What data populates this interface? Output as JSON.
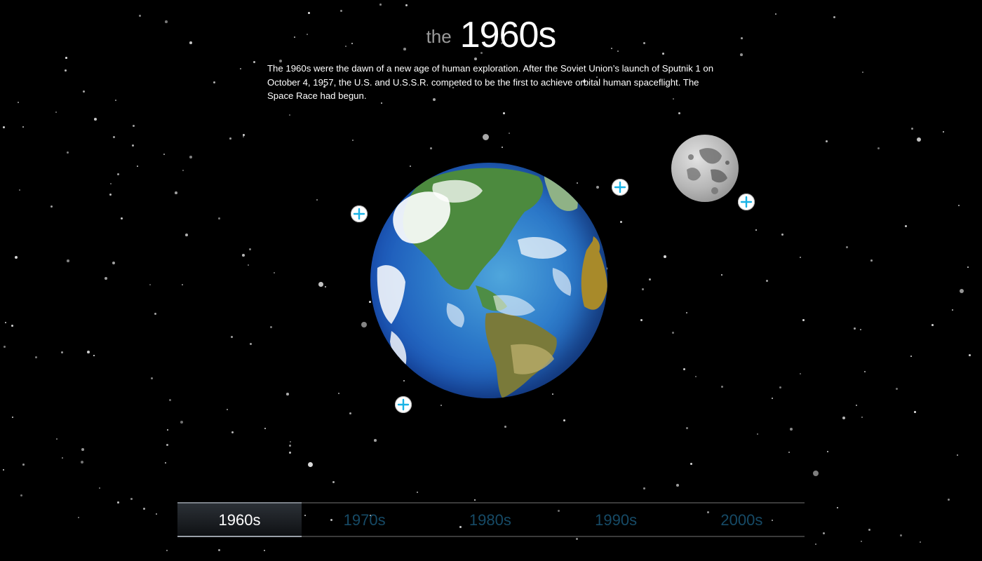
{
  "header": {
    "title_prefix": "the",
    "title_main": "1960s",
    "intro": "The 1960s were the dawn of a new age of human exploration. After the Soviet Union’s launch of Sputnik 1 on October 4, 1957, the U.S. and U.S.S.R. competed to be the first to achieve orbital human spaceflight. The Space Race had begun."
  },
  "hotspots": [
    {
      "name": "hotspot-upper-left",
      "icon": "plus-icon"
    },
    {
      "name": "hotspot-earth-orbit",
      "icon": "plus-icon"
    },
    {
      "name": "hotspot-moon",
      "icon": "plus-icon"
    },
    {
      "name": "hotspot-lower-left",
      "icon": "plus-icon"
    }
  ],
  "timeline": {
    "tabs": [
      {
        "label": "1960s",
        "active": true
      },
      {
        "label": "1970s",
        "active": false
      },
      {
        "label": "1980s",
        "active": false
      },
      {
        "label": "1990s",
        "active": false
      },
      {
        "label": "2000s",
        "active": false
      }
    ]
  },
  "colors": {
    "background": "#000000",
    "active_tab_text": "#ffffff",
    "inactive_tab_text": "#164a66",
    "hotspot_accent": "#19b3e6"
  }
}
